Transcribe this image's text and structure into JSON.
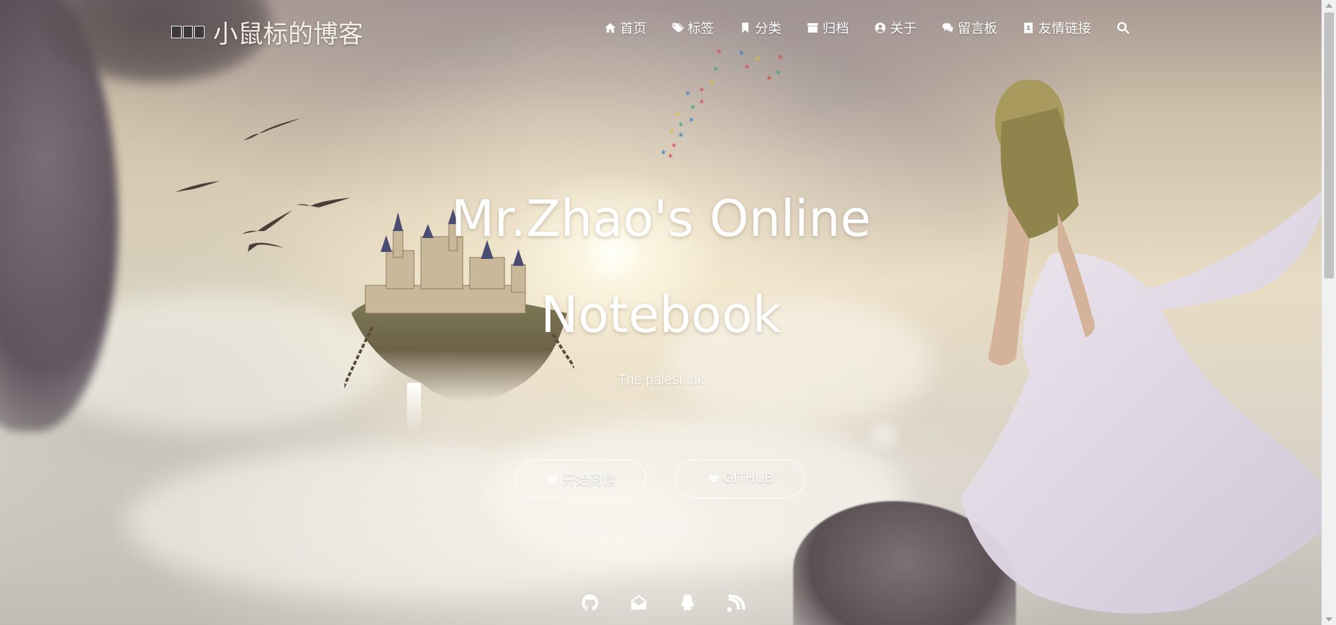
{
  "brand": {
    "logo_text": "小鼠标",
    "title": "小鼠标的博客"
  },
  "nav": {
    "items": [
      {
        "label": "首页",
        "icon": "home-icon"
      },
      {
        "label": "标签",
        "icon": "tags-icon"
      },
      {
        "label": "分类",
        "icon": "bookmark-icon"
      },
      {
        "label": "归档",
        "icon": "archive-icon"
      },
      {
        "label": "关于",
        "icon": "user-circle-icon"
      },
      {
        "label": "留言板",
        "icon": "comments-icon"
      },
      {
        "label": "友情链接",
        "icon": "address-book-icon"
      }
    ],
    "search_icon": "search-icon"
  },
  "hero": {
    "title_line1": "Mr.Zhao's Online",
    "title_line2": "Notebook",
    "subtitle": "The palest ink"
  },
  "buttons": {
    "read_label": "开始阅读",
    "read_icon": "double-chevron-down-icon",
    "github_label": "GITHUB",
    "github_icon": "github-icon"
  },
  "social": [
    {
      "name": "github-icon"
    },
    {
      "name": "envelope-icon"
    },
    {
      "name": "qq-icon"
    },
    {
      "name": "rss-icon"
    }
  ],
  "colors": {
    "text": "#ffffff",
    "scrollbar_track": "#f1f1f1",
    "scrollbar_thumb": "#c1c1c1"
  }
}
